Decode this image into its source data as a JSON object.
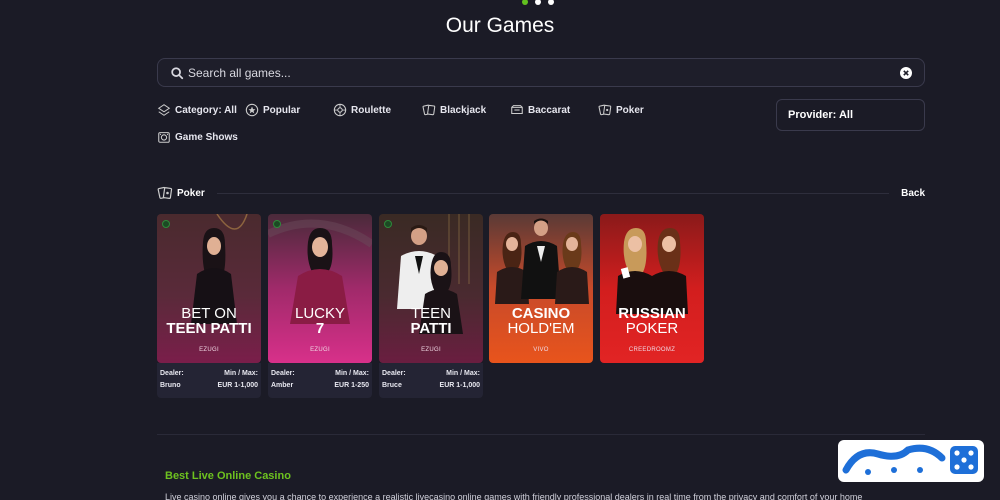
{
  "header": {
    "title": "Our Games"
  },
  "search": {
    "placeholder": "Search all games..."
  },
  "filters": [
    {
      "label": "Category: All",
      "icon": "category-icon"
    },
    {
      "label": "Popular",
      "icon": "popular-icon"
    },
    {
      "label": "Roulette",
      "icon": "roulette-icon"
    },
    {
      "label": "Blackjack",
      "icon": "blackjack-icon"
    },
    {
      "label": "Baccarat",
      "icon": "baccarat-icon"
    },
    {
      "label": "Poker",
      "icon": "poker-icon"
    },
    {
      "label": "Game Shows",
      "icon": "game-shows-icon"
    }
  ],
  "provider": {
    "label": "Provider: All"
  },
  "section": {
    "title": "Poker",
    "back_label": "Back"
  },
  "games": [
    {
      "line1": "BET ON",
      "line2": "TEEN PATTI",
      "provider": "EZUGI",
      "dealer_label": "Dealer:",
      "dealer": "Bruno",
      "minmax_label": "Min / Max:",
      "minmax": "EUR 1-1,000"
    },
    {
      "line1": "LUCKY",
      "line2": "7",
      "provider": "EZUGI",
      "dealer_label": "Dealer:",
      "dealer": "Amber",
      "minmax_label": "Min / Max:",
      "minmax": "EUR 1-250"
    },
    {
      "line1": "TEEN",
      "line2": "PATTI",
      "provider": "EZUGI",
      "dealer_label": "Dealer:",
      "dealer": "Bruce",
      "minmax_label": "Min / Max:",
      "minmax": "EUR 1-1,000"
    },
    {
      "line1": "CASINO",
      "line2": "HOLD'EM",
      "provider": "VIVO"
    },
    {
      "line1": "RUSSIAN",
      "line2": "POKER",
      "provider": "CREEDROOMZ"
    }
  ],
  "footer": {
    "title": "Best Live Online Casino",
    "text": "Live casino online gives you a chance to experience a realistic livecasino online games with friendly professional dealers in real time from the privacy and comfort of your home"
  },
  "colors": {
    "accent": "#62c11f",
    "background": "#1b1b26"
  }
}
